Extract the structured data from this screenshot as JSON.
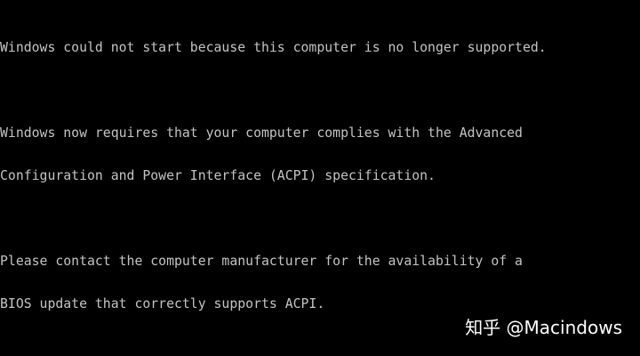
{
  "colors": {
    "background": "#000000",
    "text": "#c3c3c3",
    "watermark": "#ffffff"
  },
  "message": {
    "paragraph1": {
      "line1": "Windows could not start because this computer is no longer supported."
    },
    "paragraph2": {
      "line1": "Windows now requires that your computer complies with the Advanced",
      "line2": "Configuration and Power Interface (ACPI) specification."
    },
    "paragraph3": {
      "line1": "Please contact the computer manufacturer for the availability of a",
      "line2": "BIOS update that correctly supports ACPI."
    }
  },
  "watermark": {
    "text": "知乎 @Macindows"
  }
}
